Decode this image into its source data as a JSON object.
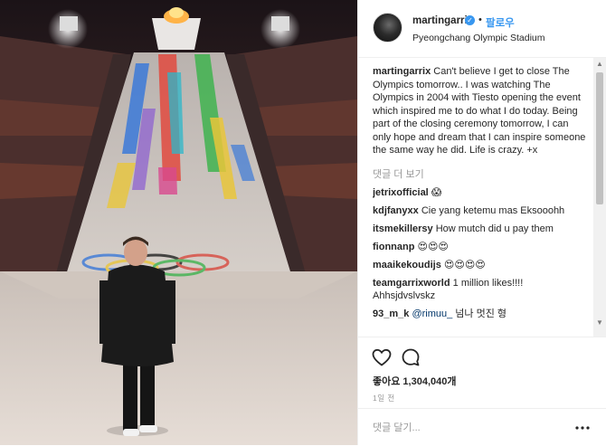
{
  "post": {
    "username": "martingarrix",
    "verified_glyph": "✓",
    "separator": "•",
    "follow_label": "팔로우",
    "location": "Pyeongchang Olympic Stadium"
  },
  "caption": {
    "username": "martingarrix",
    "text": "Can't believe I get to close The Olympics tomorrow.. I was watching The Olympics in 2004 with Tiesto opening the event which inspired me to do what I do today. Being part of the closing ceremony tomorrow, I can only hope and dream that I can inspire someone the same way he did. Life is crazy. +x"
  },
  "more_comments_label": "댓글 더 보기",
  "comments": [
    {
      "username": "jetrixofficial",
      "text": "😱"
    },
    {
      "username": "kdjfanyxx",
      "text": "Cie yang ketemu mas Eksooohh"
    },
    {
      "username": "itsmekillersy",
      "text": "How mutch did u pay them"
    },
    {
      "username": "fionnanp",
      "text": "😍😍😍"
    },
    {
      "username": "maaikekoudijs",
      "text": "😍😍😍😍"
    },
    {
      "username": "teamgarrixworld",
      "text": "1 million likes!!!! Ahhsjdvslvskz"
    },
    {
      "username": "93_m_k",
      "mention": "@rimuu_",
      "text": "넘나 멋진 형"
    }
  ],
  "likes_label": "좋아요 1,304,040개",
  "timestamp": "1일 전",
  "comment_input": {
    "placeholder": "댓글 달기..."
  },
  "icons": {
    "like": "heart-icon",
    "comment": "comment-bubble-icon",
    "options": "more-options-icon",
    "verified": "verified-badge-icon",
    "scroll_up": "scroll-up-icon",
    "scroll_down": "scroll-down-icon"
  },
  "colors": {
    "link_blue": "#3897f0",
    "text": "#262626",
    "muted": "#999999",
    "border": "#efefef"
  },
  "scrollbar": {
    "up_glyph": "▲",
    "down_glyph": "▼"
  }
}
